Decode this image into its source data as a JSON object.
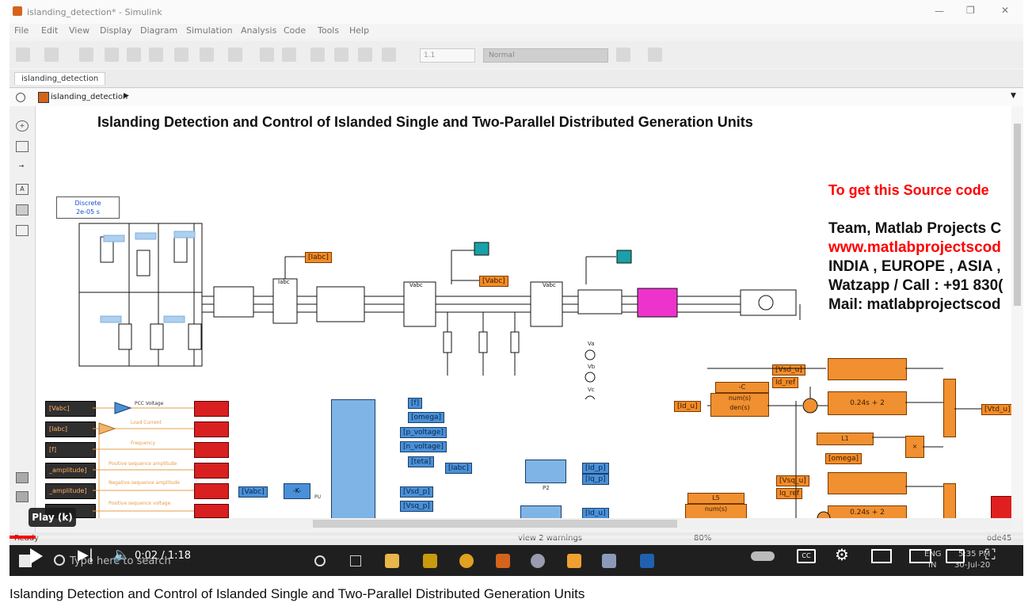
{
  "window": {
    "title": "islanding_detection* - Simulink"
  },
  "menu": [
    "File",
    "Edit",
    "View",
    "Display",
    "Diagram",
    "Simulation",
    "Analysis",
    "Code",
    "Tools",
    "Help"
  ],
  "toolbar": {
    "stop_time": "1.1",
    "sim_mode": "Normal"
  },
  "tab": {
    "label": "islanding_detection"
  },
  "address": {
    "path": "islanding_detection"
  },
  "diagram": {
    "title": "Islanding Detection and Control of Islanded Single and Two-Parallel Distributed Generation Units",
    "solver_block": {
      "line1": "Discrete",
      "line2": "2e-05 s"
    },
    "info_red": "To get this Source code",
    "info_lines": [
      "Team, Matlab Projects C",
      "www.matlabprojectscod",
      "INDIA , EUROPE , ASIA ,",
      "Watzapp / Call : +91 830(",
      "Mail: matlabprojectscod"
    ],
    "tags": {
      "iabc": "[Iabc]",
      "vabc": "[Vabc]",
      "f": "[f]",
      "omega": "[omega]",
      "p_voltage": "[p_voltage]",
      "n_voltage": "[n_voltage]",
      "teta": "[teta]",
      "vsd_p": "[Vsd_p]",
      "vsq_p": "[Vsq_p]",
      "id_p": "[Id_p]",
      "iq_p": "[Iq_p]",
      "vsd_u": "[Vsd_u]",
      "vsq_u": "[Vsq_u]",
      "id_ref": "Id_ref",
      "iq_ref": "Iq_ref",
      "vtd_u": "[Vtd_u]",
      "omega_g": "[omega]",
      "id_u": "[Id_u]"
    },
    "left_labels": [
      "[Vabc]",
      "[Iabc]",
      "[f]",
      "_amplitude]",
      "_amplitude]"
    ],
    "scope_labels": [
      "PCC Voltage",
      "Load Current",
      "Frequency",
      "Positive sequence amplitude",
      "Negative sequence amplitude",
      "Positive sequence voltage"
    ],
    "gain": "-K-",
    "pu": "PU",
    "orange_blocks": {
      "minus_c": "-C",
      "numden": "num(s)",
      "den": "den(s)",
      "tf1": "0.24s + 2",
      "tf2": "0.24s + 2",
      "l1": "L1",
      "l5": "L5",
      "numden2": "num(s)",
      "p2": "P2"
    },
    "sources": [
      "Va",
      "Vb",
      "Vc"
    ],
    "vabc_lbl": "Vabc"
  },
  "status": {
    "ready": "Ready",
    "warnings": "view 2 warnings",
    "zoom": "80%",
    "solver": "ode45"
  },
  "taskbar": {
    "search_placeholder": "Type here to search",
    "lang": "ENG",
    "region": "IN",
    "time": "5:35 PM",
    "date": "30-Jul-20"
  },
  "youtube": {
    "tooltip": "Play (k)",
    "time": "0:02 / 1:18",
    "progress": 0.026
  },
  "page": {
    "title": "Islanding Detection and Control of Islanded Single and Two-Parallel Distributed Generation Units"
  }
}
